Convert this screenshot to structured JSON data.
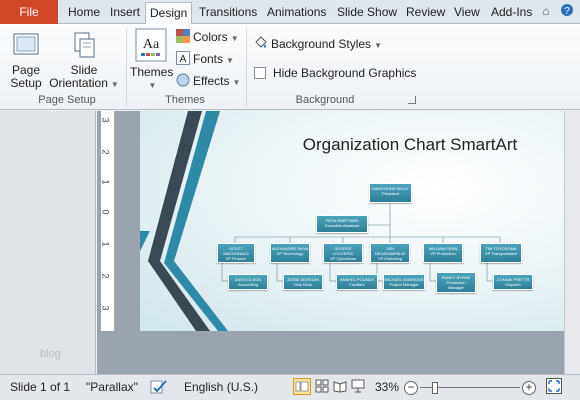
{
  "tabs": {
    "file": "File",
    "home": "Home",
    "insert": "Insert",
    "design": "Design",
    "transitions": "Transitions",
    "animations": "Animations",
    "slideshow": "Slide Show",
    "review": "Review",
    "view": "View",
    "addins": "Add-Ins"
  },
  "ribbon": {
    "page_setup": {
      "page_setup_label_1": "Page",
      "page_setup_label_2": "Setup",
      "slide_orientation_label_1": "Slide",
      "slide_orientation_label_2": "Orientation",
      "group_label": "Page Setup"
    },
    "themes": {
      "themes_label": "Themes",
      "colors_label": "Colors",
      "fonts_label": "Fonts",
      "effects_label": "Effects",
      "group_label": "Themes",
      "theme_icon_text": "Aa"
    },
    "background": {
      "background_styles_label": "Background Styles",
      "hide_graphics_label": "Hide Background Graphics",
      "group_label": "Background"
    }
  },
  "pane": {
    "watermark": "blog"
  },
  "ruler_marks": [
    "3",
    "2",
    "1",
    "0",
    "1",
    "2",
    "3"
  ],
  "slide": {
    "title": "Organization Chart SmartArt",
    "nodes": {
      "top": "MADELEINE KELLY\nPresident",
      "assistant": "PETA SHEFTAHN\nExecutive Assistant",
      "l2_1": "SCOTT\nMACDONALD\nVP Finance",
      "l2_2": "ALEXANDRE SILVA\nVP Technology",
      "l2_3": "GEORGE\nLOUVERIS\nVP Operations",
      "l2_4": "SIRI\nDELARAMPALM\nVP Marketing",
      "l2_5": "WILLIAM PENN\nVP Production",
      "l2_6": "TIM TOYODOMA\nVP Transportation",
      "l3_1": "ANITA OLSON\nAccounting",
      "l3_2": "JESSE MORGAN\nHelp Desk",
      "l3_3": "ANSHEL POUNDS\nFacilities",
      "l3_4": "MICHAEL ANDREWS\nProject Manager",
      "l3_5": "RANDY BYRNE\nProduction\nManager",
      "l3_6": "CONNIE PRETTS\nDispatch"
    }
  },
  "status": {
    "slide_count": "Slide 1 of 1",
    "theme_name": "\"Parallax\"",
    "language": "English (U.S.)",
    "zoom": "33%"
  },
  "colors": {
    "file_tab": "#d24726",
    "node_fill": "#3a93ad",
    "swoosh_dark": "#3a4a55",
    "swoosh_teal": "#2e8aa6"
  }
}
